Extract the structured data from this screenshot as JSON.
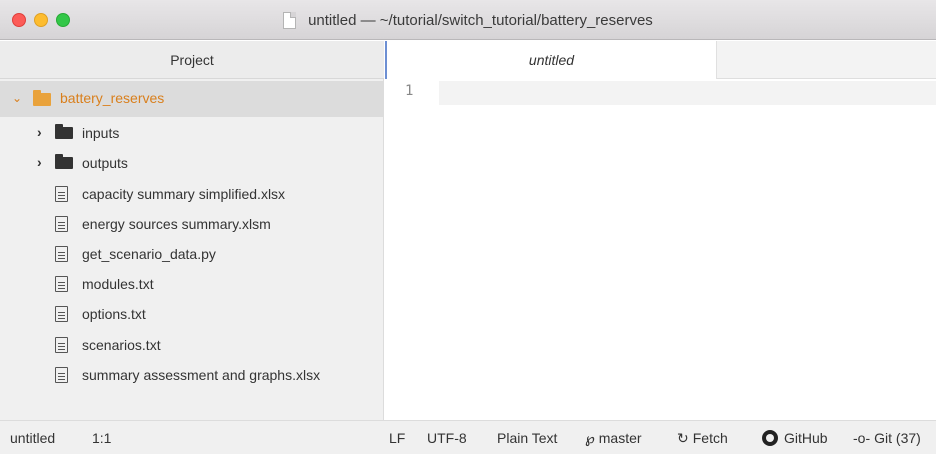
{
  "window": {
    "title": "untitled — ~/tutorial/switch_tutorial/battery_reserves"
  },
  "sidebar": {
    "header": "Project",
    "root": {
      "label": "battery_reserves",
      "icon": "folder-icon",
      "expanded": true
    },
    "folders": [
      {
        "label": "inputs",
        "icon": "folder-icon"
      },
      {
        "label": "outputs",
        "icon": "folder-icon"
      }
    ],
    "files": [
      {
        "label": "capacity summary simplified.xlsx",
        "icon": "file-icon"
      },
      {
        "label": "energy sources summary.xlsm",
        "icon": "file-icon"
      },
      {
        "label": "get_scenario_data.py",
        "icon": "file-icon"
      },
      {
        "label": "modules.txt",
        "icon": "file-icon"
      },
      {
        "label": "options.txt",
        "icon": "file-icon"
      },
      {
        "label": "scenarios.txt",
        "icon": "file-icon"
      },
      {
        "label": "summary assessment and graphs.xlsx",
        "icon": "file-icon"
      }
    ]
  },
  "editor": {
    "tab_label": "untitled",
    "line_number": "1"
  },
  "statusbar": {
    "file": "untitled",
    "cursor": "1:1",
    "line_ending": "LF",
    "encoding": "UTF-8",
    "grammar": "Plain Text",
    "branch": "master",
    "fetch": "Fetch",
    "github": "GitHub",
    "git": "Git (37)"
  },
  "colors": {
    "accent_orange": "#d97f1c",
    "tab_accent": "#6d8fd3"
  }
}
